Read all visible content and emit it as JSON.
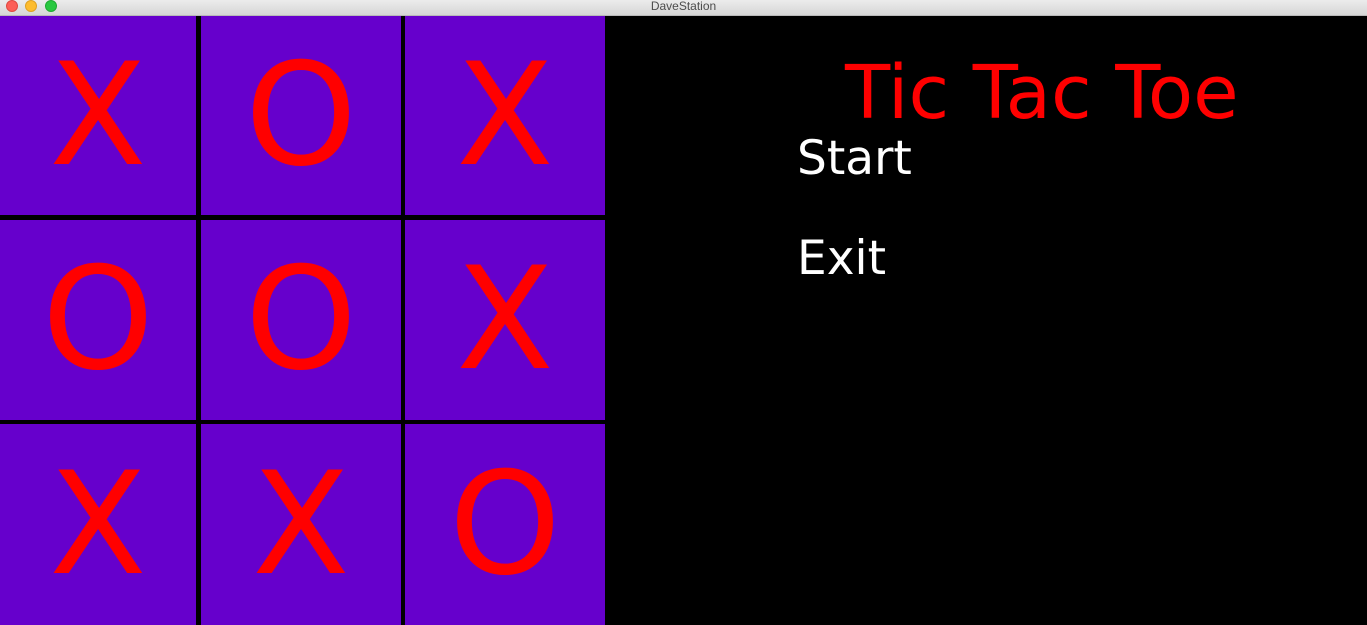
{
  "window": {
    "title": "DaveStation",
    "controls": [
      "close",
      "minimize",
      "maximize"
    ]
  },
  "game": {
    "title": "Tic Tac Toe",
    "menu": {
      "start_label": "Start",
      "exit_label": "Exit"
    },
    "board": [
      [
        "X",
        "O",
        "X"
      ],
      [
        "O",
        "O",
        "X"
      ],
      [
        "X",
        "X",
        "O"
      ]
    ]
  },
  "colors": {
    "background": "#000000",
    "cell_fill": "#6600cc",
    "mark": "#ff0000",
    "title": "#ff0000",
    "menu_text": "#ffffff"
  }
}
